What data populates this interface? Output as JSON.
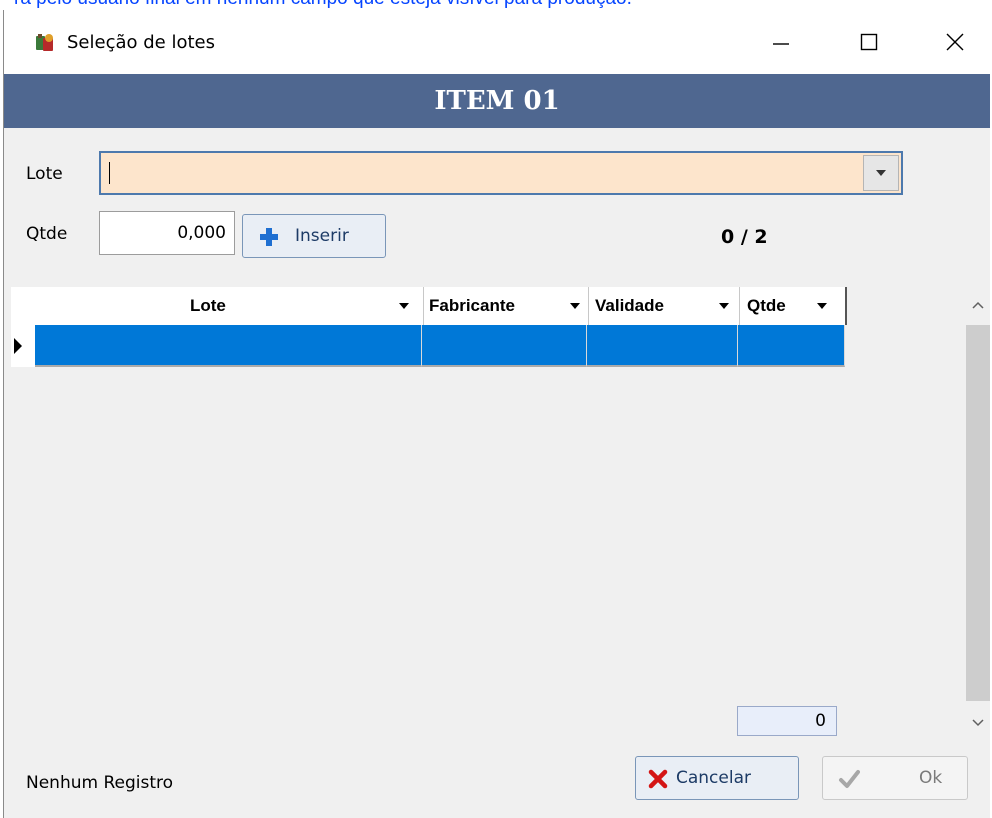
{
  "background_link": {
    "text": "ra pelo usuário final em nenhum campo que esteja visível para produção."
  },
  "window": {
    "title": "Seleção de lotes",
    "controls": {
      "minimize": "—",
      "maximize": "☐",
      "close": "✕"
    }
  },
  "header": {
    "title": "ITEM 01"
  },
  "form": {
    "lote_label": "Lote",
    "lote_value": "",
    "qtde_label": "Qtde",
    "qtde_value": "0,000",
    "insert_button": "Inserir",
    "counter": "0 / 2"
  },
  "grid": {
    "columns": [
      "Lote",
      "Fabricante",
      "Validade",
      "Qtde"
    ],
    "rows": [
      {
        "lote": "",
        "fabricante": "",
        "validade": "",
        "qtde": ""
      }
    ]
  },
  "footer": {
    "total": "0",
    "status": "Nenhum Registro",
    "cancel_button": "Cancelar",
    "ok_button": "Ok"
  },
  "colors": {
    "header_band": "#4f6790",
    "selected_row": "#0078d7",
    "combo_fill": "#fde5cc",
    "combo_border": "#4d79ad"
  },
  "icons": {
    "app": "app-icon",
    "insert": "plus-icon",
    "cancel": "x-icon",
    "ok": "check-icon",
    "dropdown": "chevron-down-icon"
  }
}
